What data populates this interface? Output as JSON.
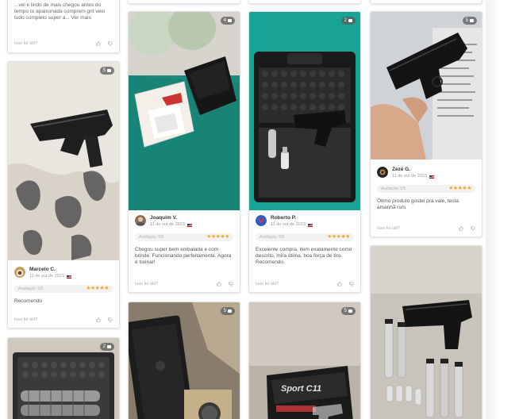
{
  "reviews": [
    {
      "text": "...vel e lindo de mais chegou antes do tempo to apaixonada comprem gnt veio tudo completo super a... Ver mais",
      "useful_label": "Isso foi útil?"
    },
    {
      "photo_count": "5",
      "name": "Marcelo C.",
      "date": "11 de out de 2023",
      "rating_label": "Avaliação: 5/5",
      "stars": "★★★★★",
      "text": "Recomendo",
      "useful_label": "Isso foi útil?"
    },
    {
      "photo_count": "2"
    },
    {
      "photo_count": "4",
      "name": "Joaquim V.",
      "date": "11 de out de 2023",
      "rating_label": "Avaliação: 5/5",
      "stars": "★★★★★",
      "text": "Chegou super bem embalada e com brinde. Funcionando perfeitamente. Agora é treinar!",
      "useful_label": "Isso foi útil?"
    },
    {
      "photo_count": "5"
    },
    {
      "photo_count": "2",
      "name": "Roberto P.",
      "date": "11 de out de 2023",
      "rating_label": "Avaliação: 5/5",
      "stars": "★★★★★",
      "text": "Excelente compra, item exatamente como descrito, mira ótima, boa força de tiro. Recomendo.",
      "useful_label": "Isso foi útil?"
    },
    {
      "photo_count": "5",
      "box_text": "Sport C11"
    },
    {
      "photo_count": "5",
      "name": "Zezé G.",
      "date": "11 de out de 2023",
      "rating_label": "Avaliação: 5/5",
      "stars": "★★★★★",
      "text": "Ótimo produto gostei pra vale, testa amanhã rsrs",
      "useful_label": "Isso foi útil?"
    },
    {
      "photo_count": null
    }
  ]
}
